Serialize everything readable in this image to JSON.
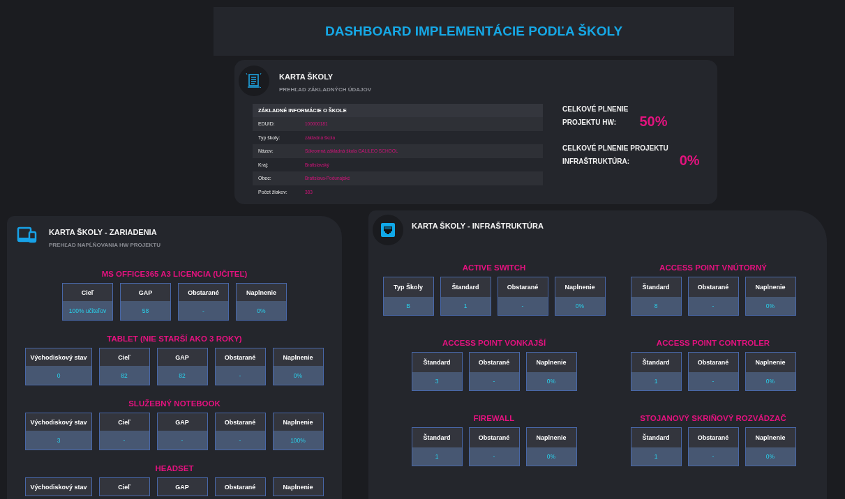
{
  "header": {
    "title": "DASHBOARD IMPLEMENTÁCIE PODĽA ŠKOLY"
  },
  "school_card": {
    "title": "KARTA ŠKOLY",
    "subtitle": "PREHĽAD ZÁKLADNÝCH ÚDAJOV",
    "info_table": {
      "heading": "ZÁKLADNÉ INFORMÁCIE O ŠKOLE",
      "rows": [
        {
          "label": "EDUID:",
          "value": "100000181"
        },
        {
          "label": "Typ školy:",
          "value": "základná škola"
        },
        {
          "label": "Názov:",
          "value": "Súkromná základná škola GALILEO SCHOOL"
        },
        {
          "label": "Kraj:",
          "value": "Bratislavský"
        },
        {
          "label": "Obec:",
          "value": "Bratislava-Podunajské"
        },
        {
          "label": "Počet žiakov:",
          "value": "383"
        }
      ]
    },
    "totals": [
      {
        "label_lines": [
          "CELKOVÉ PLNENIE",
          "PROJEKTU HW:"
        ],
        "value": "50%"
      },
      {
        "label_lines": [
          "CELKOVÉ PLNENIE PROJEKTU",
          "INFRAŠTRUKTÚRA:"
        ],
        "value": "0%"
      }
    ]
  },
  "devices_card": {
    "title": "KARTA ŠKOLY - ZARIADENIA",
    "subtitle": "PREHĽAD NAPĹŇOVANIA HW PROJEKTU",
    "groups": [
      {
        "title": "MS OFFICE365 A3 LICENCIA (UČITEĽ)",
        "columns": [
          {
            "label": "Cieľ",
            "value": "100% učiteľov"
          },
          {
            "label": "GAP",
            "value": "58"
          },
          {
            "label": "Obstarané",
            "value": "-"
          },
          {
            "label": "Naplnenie",
            "value": "0%"
          }
        ]
      },
      {
        "title": "TABLET (NIE STARŠÍ AKO 3 ROKY)",
        "columns": [
          {
            "label": "Východiskový stav",
            "value": "0"
          },
          {
            "label": "Cieľ",
            "value": "82"
          },
          {
            "label": "GAP",
            "value": "82"
          },
          {
            "label": "Obstarané",
            "value": "-"
          },
          {
            "label": "Naplnenie",
            "value": "0%"
          }
        ]
      },
      {
        "title": "SLUŽEBNÝ NOTEBOOK",
        "columns": [
          {
            "label": "Východiskový stav",
            "value": "3"
          },
          {
            "label": "Cieľ",
            "value": "-"
          },
          {
            "label": "GAP",
            "value": "-"
          },
          {
            "label": "Obstarané",
            "value": "-"
          },
          {
            "label": "Naplnenie",
            "value": "100%"
          }
        ]
      },
      {
        "title": "HEADSET",
        "columns": [
          {
            "label": "Východiskový stav"
          },
          {
            "label": "Cieľ"
          },
          {
            "label": "GAP"
          },
          {
            "label": "Obstarané"
          },
          {
            "label": "Naplnenie"
          }
        ]
      }
    ]
  },
  "infra_card": {
    "title": "KARTA ŠKOLY - INFRAŠTRUKTÚRA",
    "groups": [
      {
        "title": "ACTIVE SWITCH",
        "columns": [
          {
            "label": "Typ Školy",
            "value": "B"
          },
          {
            "label": "Štandard",
            "value": "1"
          },
          {
            "label": "Obstarané",
            "value": "-"
          },
          {
            "label": "Naplnenie",
            "value": "0%"
          }
        ]
      },
      {
        "title": "ACCESS POINT VNÚTORNÝ",
        "columns": [
          {
            "label": "Štandard",
            "value": "8"
          },
          {
            "label": "Obstarané",
            "value": "-"
          },
          {
            "label": "Naplnenie",
            "value": "0%"
          }
        ]
      },
      {
        "title": "ACCESS POINT VONKAJŠÍ",
        "columns": [
          {
            "label": "Štandard",
            "value": "3"
          },
          {
            "label": "Obstarané",
            "value": "-"
          },
          {
            "label": "Naplnenie",
            "value": "0%"
          }
        ]
      },
      {
        "title": "ACCESS POINT CONTROLER",
        "columns": [
          {
            "label": "Štandard",
            "value": "1"
          },
          {
            "label": "Obstarané",
            "value": "-"
          },
          {
            "label": "Naplnenie",
            "value": "0%"
          }
        ]
      },
      {
        "title": "FIREWALL",
        "columns": [
          {
            "label": "Štandard",
            "value": "1"
          },
          {
            "label": "Obstarané",
            "value": "-"
          },
          {
            "label": "Naplnenie",
            "value": "0%"
          }
        ]
      },
      {
        "title": "STOJANOVÝ SKRIŇOVÝ ROZVÁDZAČ",
        "columns": [
          {
            "label": "Štandard",
            "value": "1"
          },
          {
            "label": "Obstarané",
            "value": "-"
          },
          {
            "label": "Naplnenie",
            "value": "0%"
          }
        ]
      }
    ]
  }
}
